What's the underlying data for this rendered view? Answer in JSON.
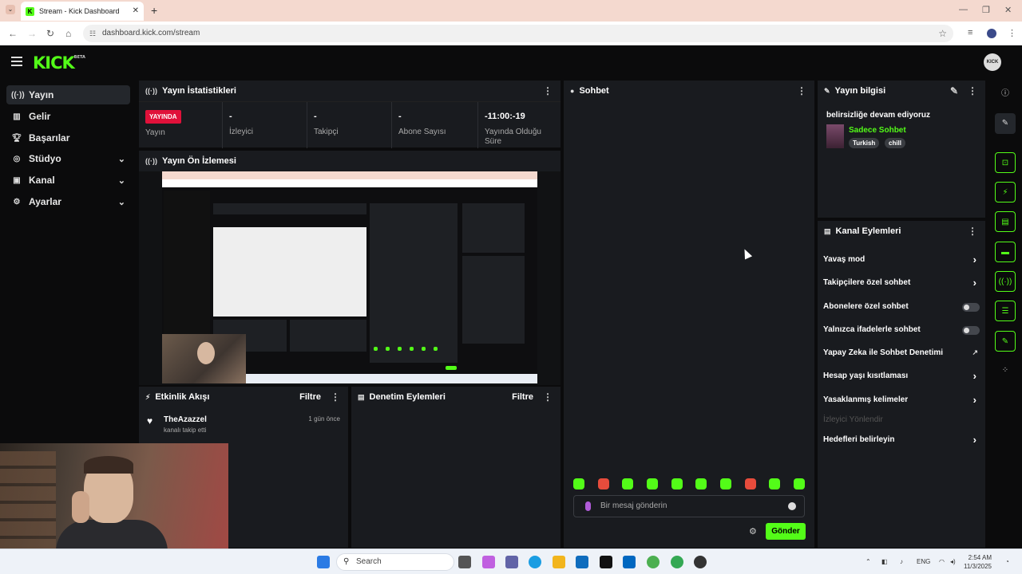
{
  "browser": {
    "tab_title": "Stream - Kick Dashboard",
    "url": "dashboard.kick.com/stream"
  },
  "header": {
    "logo": "KICK",
    "logo_badge": "BETA",
    "avatar_text": "KICK"
  },
  "sidebar": {
    "items": [
      {
        "label": "Yayın",
        "icon": "broadcast-icon"
      },
      {
        "label": "Gelir",
        "icon": "chart-icon"
      },
      {
        "label": "Başarılar",
        "icon": "trophy-icon"
      },
      {
        "label": "Stüdyo",
        "icon": "studio-icon"
      },
      {
        "label": "Kanal",
        "icon": "channel-icon"
      },
      {
        "label": "Ayarlar",
        "icon": "gear-icon"
      }
    ]
  },
  "stats_panel": {
    "title": "Yayın İstatistikleri",
    "live_badge": "YAYINDA",
    "live_label": "Yayın",
    "viewers_value": "-",
    "viewers_label": "İzleyici",
    "followers_value": "-",
    "followers_label": "Takipçi",
    "subs_value": "-",
    "subs_label": "Abone Sayısı",
    "duration_value": "-11:00:-19",
    "duration_label": "Yayında Olduğu Süre"
  },
  "preview_panel": {
    "title": "Yayın Ön İzlemesi"
  },
  "activity_panel": {
    "title": "Etkinlik Akışı",
    "filter": "Filtre",
    "items": [
      {
        "user": "TheAzazzel",
        "action": "kanalı takip etti",
        "time": "1 gün önce"
      }
    ]
  },
  "moderation_panel": {
    "title": "Denetim Eylemleri",
    "filter": "Filtre"
  },
  "chat_panel": {
    "title": "Sohbet",
    "input_placeholder": "Bir mesaj gönderin",
    "send_label": "Gönder"
  },
  "stream_info": {
    "title": "Yayın bilgisi",
    "stream_title": "belirsizliğe devam ediyoruz",
    "category": "Sadece Sohbet",
    "tags": [
      "Turkish",
      "chill"
    ]
  },
  "channel_actions": {
    "title": "Kanal Eylemleri",
    "items": [
      {
        "label": "Yavaş mod",
        "control": "arrow"
      },
      {
        "label": "Takipçilere özel sohbet",
        "control": "arrow"
      },
      {
        "label": "Abonelere özel sohbet",
        "control": "toggle"
      },
      {
        "label": "Yalnızca ifadelerle sohbet",
        "control": "toggle"
      },
      {
        "label": "Yapay Zeka ile Sohbet Denetimi",
        "control": "external"
      },
      {
        "label": "Hesap yaşı kısıtlaması",
        "control": "arrow"
      },
      {
        "label": "Yasaklanmış kelimeler",
        "control": "arrow"
      },
      {
        "label": "İzleyici Yönlendir",
        "control": "none"
      },
      {
        "label": "Hedefleri belirleyin",
        "control": "arrow"
      }
    ]
  },
  "taskbar": {
    "search_placeholder": "Search",
    "lang": "ENG",
    "time": "2:54 AM",
    "date": "11/3/2025"
  },
  "colors": {
    "brand": "#53fc18",
    "live": "#e0113a",
    "panel": "#191b1f",
    "background": "#0b0b0c"
  }
}
